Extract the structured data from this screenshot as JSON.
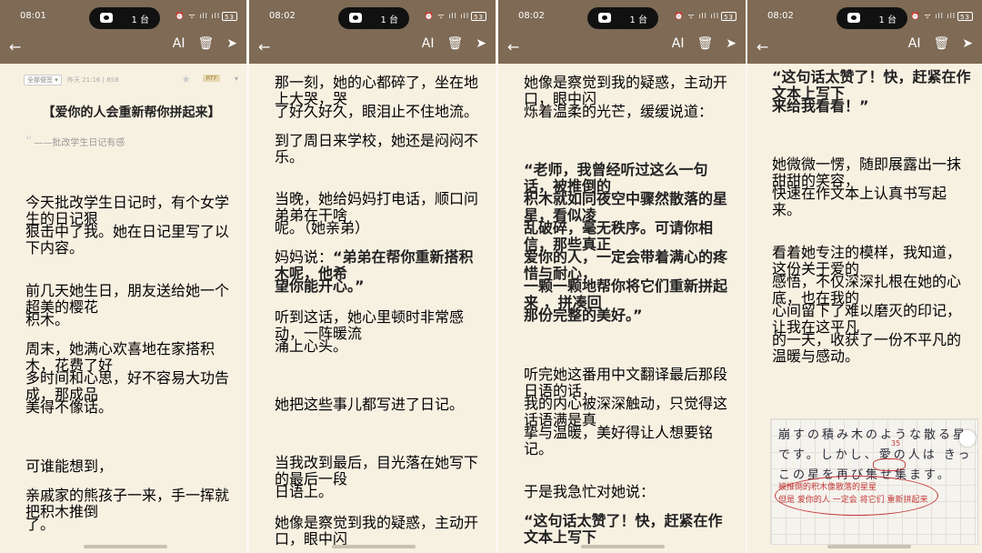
{
  "status": {
    "signal_glyphs": "⏰ ᯤ ıll ıll",
    "battery": "53",
    "dynamic_island_count": "1 台"
  },
  "times": [
    "08:01",
    "08:02",
    "08:02",
    "08:02"
  ],
  "toolbar": {
    "back": "←",
    "ai": "AI",
    "delete": "🗑",
    "send": "➤"
  },
  "note_header": {
    "folder": "全部便签 ▾",
    "meta": "昨天 21:16 | 858",
    "badge": "RTF",
    "star": "★",
    "dropdown": "▾"
  },
  "panel1": {
    "title": "【爱你的人会重新帮你拼起来】",
    "subtitle": "——批改学生日记有感",
    "lines": [
      "今天批改学生日记时，有个女学生的日记狠",
      "狠击中了我。她在日记里写了以下内容。",
      "前几天她生日，朋友送给她一个超美的樱花",
      "积木。",
      "周末，她满心欢喜地在家搭积木，花费了好",
      "多时间和心思，好不容易大功告成，那成品",
      "美得不像话。",
      "可谁能想到，",
      "亲戚家的熊孩子一来，手一挥就把积木推倒",
      "了。"
    ]
  },
  "panel2": {
    "lines": [
      "那一刻，她的心都碎了，坐在地上大哭，哭",
      "了好久好久，眼泪止不住地流。",
      "到了周日来学校，她还是闷闷不乐。",
      "当晚，她给妈妈打电话，顺口问弟弟在干啥",
      "呢。（她亲弟）",
      "妈妈说：",
      "“弟弟在帮你重新搭积木呢，他希",
      "望你能开心。”",
      "听到这话，她心里顿时非常感动，一阵暖流",
      "涌上心头。",
      "她把这些事儿都写进了日记。",
      "当我改到最后，目光落在她写下的最后一段",
      "日语上。",
      "她像是察觉到我的疑惑，主动开口，眼中闪"
    ]
  },
  "panel3": {
    "lines": [
      "她像是察觉到我的疑惑，主动开口，眼中闪",
      "烁着温柔的光芒，缓缓说道：",
      "“老师，我曾经听过这么一句话，被推倒的",
      "积木就如同夜空中骤然散落的星星，看似凌",
      "乱破碎，毫无秩序。可请你相信，那些真正",
      "爱你的人，一定会带着满心的疼惜与耐心，",
      "一颗一颗地帮你将它们重新拼起来 ，拼凑回",
      "那份完整的美好。”",
      "听完她这番用中文翻译最后那段日语的话，",
      "我的内心被深深触动，只觉得这话语满是真",
      "挚与温暖，美好得让人想要铭记。",
      "于是我急忙对她说：",
      "“这句话太赞了！快，赶紧在作文本上写下"
    ]
  },
  "panel4": {
    "lines": [
      "“这句话太赞了！快，赶紧在作文本上写下",
      "来给我看看！”",
      "她微微一愣，随即展露出一抹甜甜的笑容，",
      "快速在作文本上认真书写起来。",
      "看着她专注的模样，我知道，这份关于爱的",
      "感悟，不仅深深扎根在她的心底，也在我的",
      "心间留下了难以磨灭的印记，让我在这平凡",
      "的一天，收获了一份不平凡的温暖与感动。"
    ]
  },
  "photo": {
    "jp_lines": [
      "崩すの積み木のような散る星",
      "です。しかし、愛の人は きっ",
      "この星を再び集せ集ます。"
    ],
    "annot": "35",
    "cn_lines": [
      "被推倒的积木像散落的星星",
      "但是 爱你的人 一定会 将它们 重新拼起来"
    ]
  }
}
